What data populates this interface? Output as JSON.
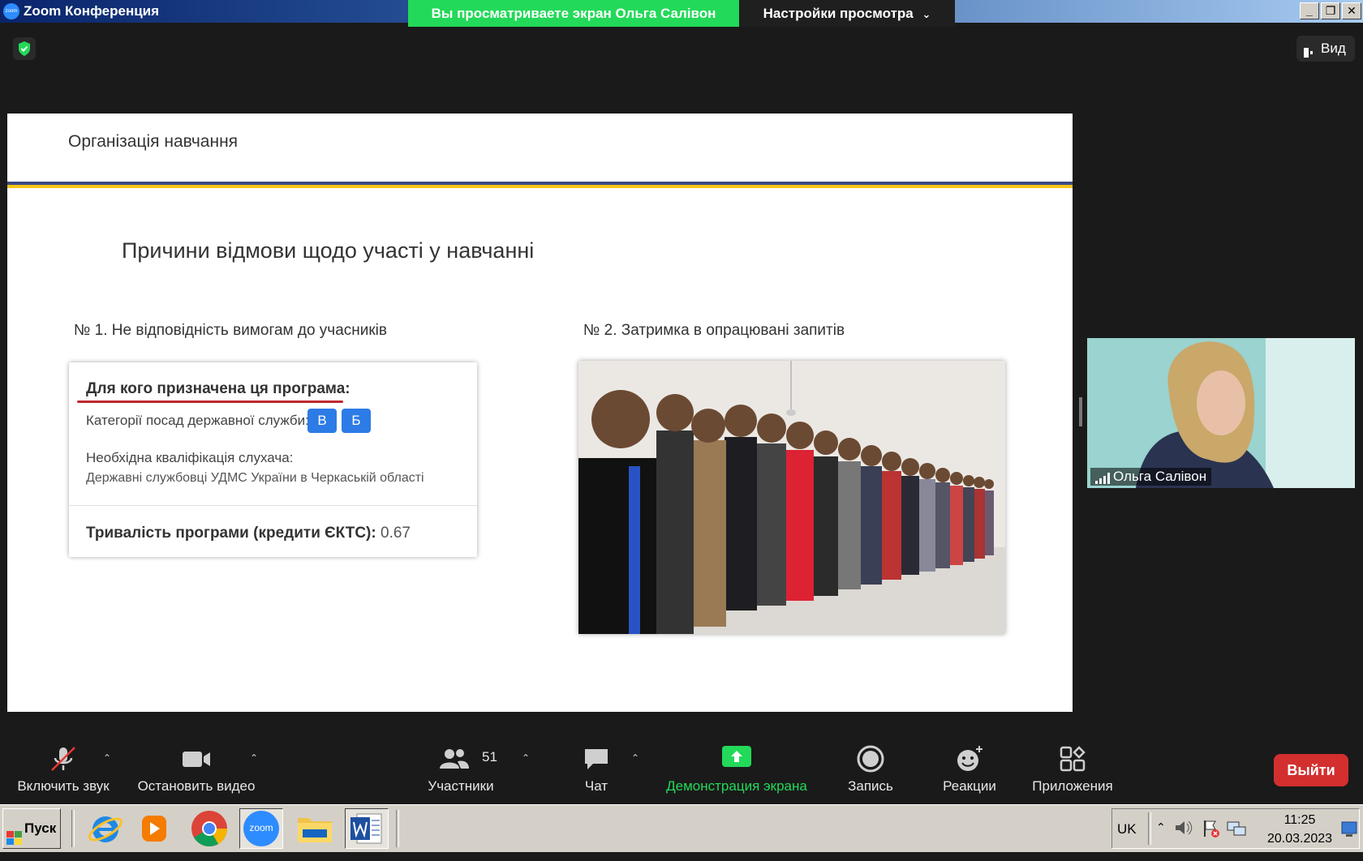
{
  "window": {
    "app_icon_text": "zoom",
    "title": "Zoom Конференция",
    "share_banner": "Вы просматриваете экран Ольга Салівон",
    "view_options": "Настройки просмотра",
    "min_glyph": "_",
    "max_glyph": "❐",
    "close_glyph": "✕"
  },
  "top": {
    "view_label": "Вид"
  },
  "slide": {
    "header": "Організація навчання",
    "title": "Причини відмови щодо участі у навчанні",
    "left_subtitle": "№ 1. Не відповідність вимогам до учасників",
    "right_subtitle": "№ 2. Затримка в опрацювані запитів",
    "card": {
      "heading": "Для кого призначена ця програма:",
      "categories_label": "Категорії посад державної служби:",
      "badges": [
        "В",
        "Б"
      ],
      "qualification_label": "Необхідна кваліфікація слухача:",
      "qualification_value": "Державні службовці УДМС України в Черкаській області",
      "duration_label": "Тривалість програми (кредити ЄКТС):",
      "duration_value": "0.67"
    },
    "colors": {
      "blue_bar": "#3b4a86",
      "yellow_bar": "#f5c518",
      "underline": "#c1272d",
      "badge": "#2d7be6"
    }
  },
  "participant": {
    "name": "Ольга Салівон"
  },
  "controls": {
    "mute": "Включить звук",
    "video": "Остановить видео",
    "participants": "Участники",
    "participants_count": "51",
    "chat": "Чат",
    "share": "Демонстрация экрана",
    "record": "Запись",
    "reactions": "Реакции",
    "apps": "Приложения",
    "leave": "Выйти",
    "share_color": "#23d959"
  },
  "taskbar": {
    "start": "Пуск",
    "zoom_app_text": "zoom",
    "language": "UK",
    "time": "11:25",
    "date": "20.03.2023"
  }
}
